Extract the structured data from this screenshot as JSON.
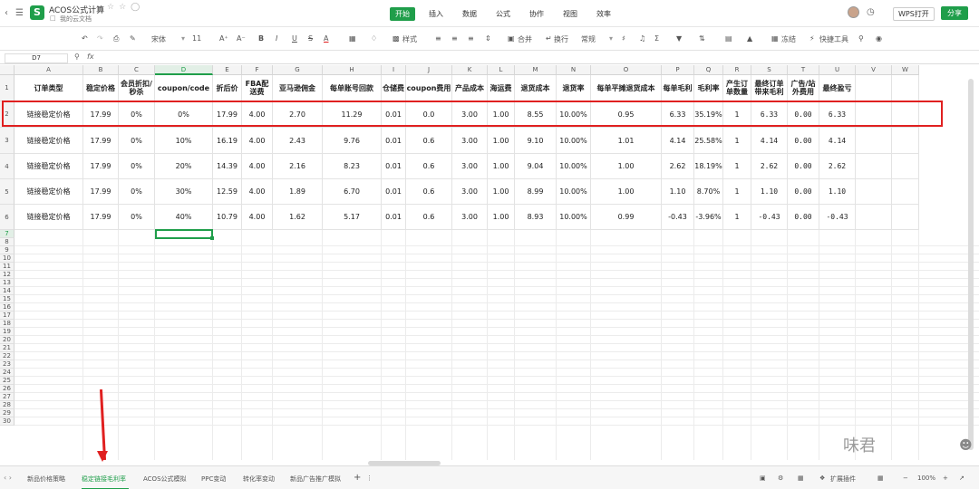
{
  "titlebar": {
    "doc_title": "ACOS公式计算",
    "doc_location": "我的云文档",
    "menu": [
      "开始",
      "插入",
      "数据",
      "公式",
      "协作",
      "视图",
      "效率"
    ],
    "wps_open": "WPS打开",
    "share": "分享"
  },
  "toolbar": {
    "font": "宋体",
    "font_size": "11",
    "number_format": "常规",
    "style": "样式",
    "merge": "合并",
    "wrap": "换行",
    "freeze": "冻结",
    "quick_tools": "快捷工具"
  },
  "formula_bar": {
    "cell_ref": "D7",
    "fx": "fx"
  },
  "columns": [
    "A",
    "B",
    "C",
    "D",
    "E",
    "F",
    "G",
    "H",
    "I",
    "J",
    "K",
    "L",
    "M",
    "N",
    "O",
    "P",
    "Q",
    "R",
    "S",
    "T",
    "U",
    "V",
    "W"
  ],
  "header_row": [
    "订单类型",
    "稳定价格",
    "会员折扣/秒杀",
    "coupon/code",
    "折后价",
    "FBA配送费",
    "亚马逊佣金",
    "每单账号回款",
    "仓储费",
    "coupon费用",
    "产品成本",
    "海运费",
    "退货成本",
    "退货率",
    "每单平摊退货成本",
    "每单毛利",
    "毛利率",
    "产生订单数量",
    "最终订单带来毛利",
    "广告/站外费用",
    "最终盈亏"
  ],
  "data_rows": [
    [
      "链接稳定价格",
      "17.99",
      "0%",
      "0%",
      "17.99",
      "4.00",
      "2.70",
      "11.29",
      "0.01",
      "0.0",
      "3.00",
      "1.00",
      "8.55",
      "10.00%",
      "0.95",
      "6.33",
      "35.19%",
      "1",
      "6.33",
      "0.00",
      "6.33"
    ],
    [
      "链接稳定价格",
      "17.99",
      "0%",
      "10%",
      "16.19",
      "4.00",
      "2.43",
      "9.76",
      "0.01",
      "0.6",
      "3.00",
      "1.00",
      "9.10",
      "10.00%",
      "1.01",
      "4.14",
      "25.58%",
      "1",
      "4.14",
      "0.00",
      "4.14"
    ],
    [
      "链接稳定价格",
      "17.99",
      "0%",
      "20%",
      "14.39",
      "4.00",
      "2.16",
      "8.23",
      "0.01",
      "0.6",
      "3.00",
      "1.00",
      "9.04",
      "10.00%",
      "1.00",
      "2.62",
      "18.19%",
      "1",
      "2.62",
      "0.00",
      "2.62"
    ],
    [
      "链接稳定价格",
      "17.99",
      "0%",
      "30%",
      "12.59",
      "4.00",
      "1.89",
      "6.70",
      "0.01",
      "0.6",
      "3.00",
      "1.00",
      "8.99",
      "10.00%",
      "1.00",
      "1.10",
      "8.70%",
      "1",
      "1.10",
      "0.00",
      "1.10"
    ],
    [
      "链接稳定价格",
      "17.99",
      "0%",
      "40%",
      "10.79",
      "4.00",
      "1.62",
      "5.17",
      "0.01",
      "0.6",
      "3.00",
      "1.00",
      "8.93",
      "10.00%",
      "0.99",
      "-0.43",
      "-3.96%",
      "1",
      "-0.43",
      "0.00",
      "-0.43"
    ]
  ],
  "sheet_tabs": [
    "新品价格策略",
    "稳定链接毛利率",
    "ACOS公式模拟",
    "PPC变动",
    "转化率变动",
    "新品广告推广模拟"
  ],
  "active_tab": "稳定链接毛利率",
  "status_bar": {
    "ext": "扩展插件",
    "zoom": "100%"
  },
  "watermark": "味君",
  "colors": {
    "accent": "#1f9e4a",
    "highlight": "#e02020"
  }
}
